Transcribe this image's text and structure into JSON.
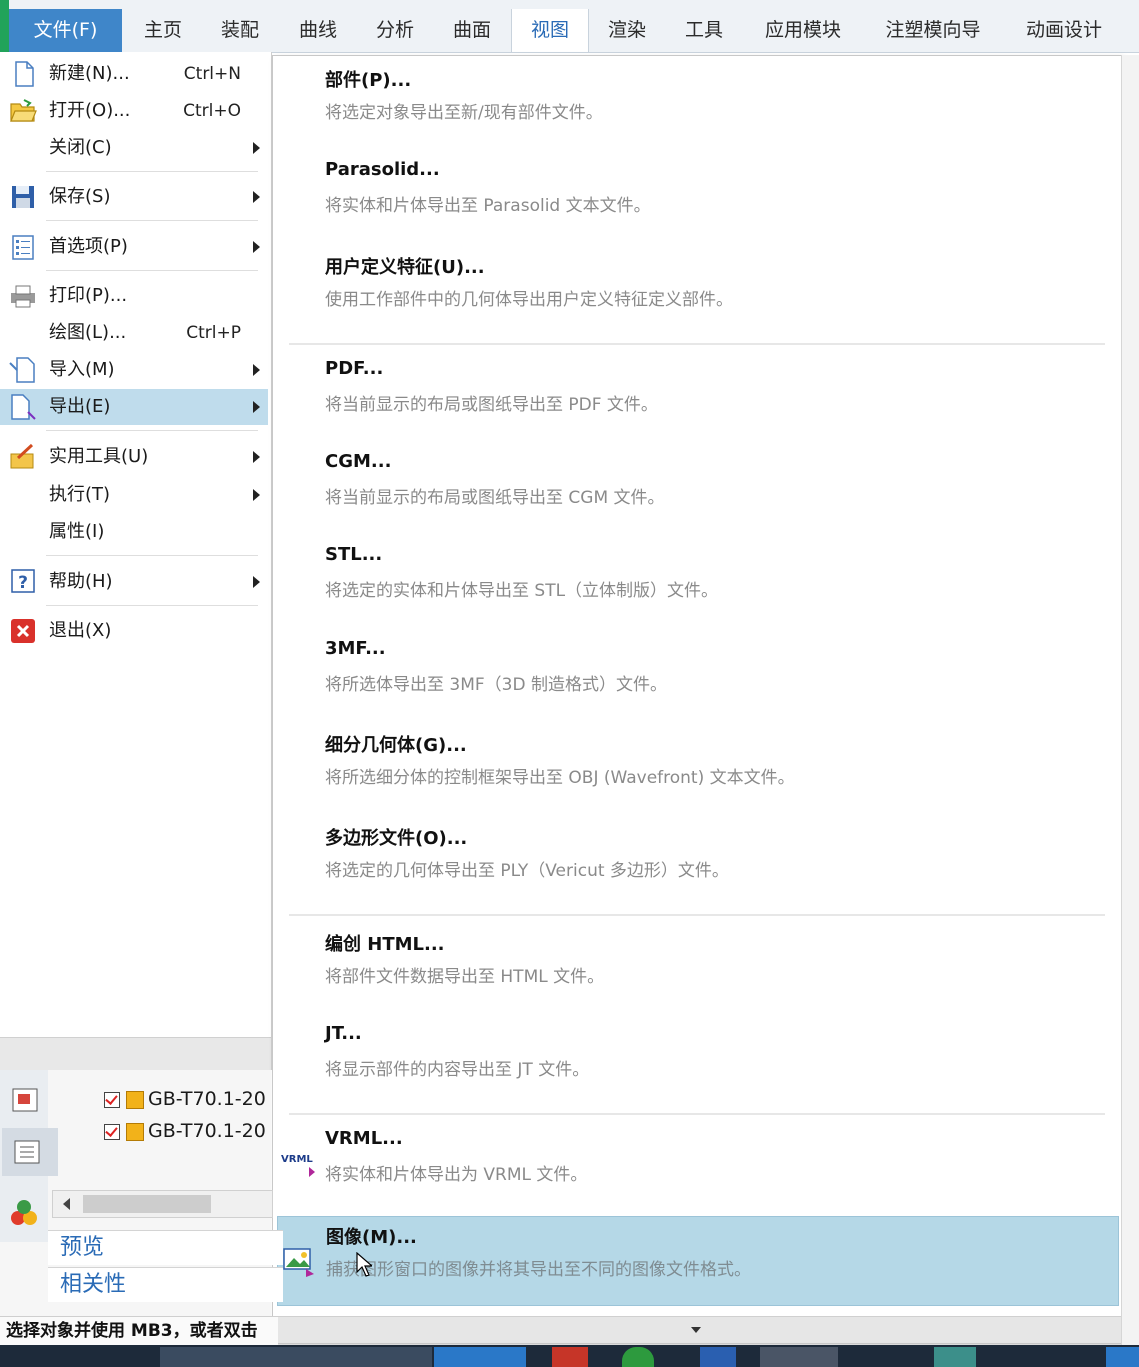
{
  "ribbon": {
    "file_tab": "文件(F)",
    "tabs": [
      "主页",
      "装配",
      "曲线",
      "分析",
      "曲面",
      "视图",
      "渲染",
      "工具",
      "应用模块",
      "注塑模向导",
      "动画设计"
    ],
    "active_tab": "视图"
  },
  "file_menu": {
    "items": [
      {
        "label": "新建(N)...",
        "shortcut": "Ctrl+N",
        "icon": "new-file-icon"
      },
      {
        "label": "打开(O)...",
        "shortcut": "Ctrl+O",
        "icon": "open-folder-icon"
      },
      {
        "label": "关闭(C)",
        "icon": ""
      },
      {
        "label": "保存(S)",
        "icon": "save-disk-icon"
      },
      {
        "label": "首选项(P)",
        "icon": "preferences-list-icon"
      },
      {
        "label": "打印(P)...",
        "icon": "printer-icon"
      },
      {
        "label": "绘图(L)...",
        "shortcut": "Ctrl+P",
        "icon": ""
      },
      {
        "label": "导入(M)",
        "icon": "import-file-icon"
      },
      {
        "label": "导出(E)",
        "icon": "export-file-icon"
      },
      {
        "label": "实用工具(U)",
        "icon": "utilities-icon"
      },
      {
        "label": "执行(T)",
        "icon": ""
      },
      {
        "label": "属性(I)",
        "icon": ""
      },
      {
        "label": "帮助(H)",
        "icon": "help-icon"
      },
      {
        "label": "退出(X)",
        "icon": "exit-icon"
      }
    ],
    "highlighted": "导出(E)"
  },
  "export_menu": {
    "items": [
      {
        "title": "部件(P)...",
        "desc": "将选定对象导出至新/现有部件文件。"
      },
      {
        "title": "Parasolid...",
        "desc": "将实体和片体导出至 Parasolid 文本文件。"
      },
      {
        "title": "用户定义特征(U)...",
        "desc": "使用工作部件中的几何体导出用户定义特征定义部件。"
      },
      {
        "title": "PDF...",
        "desc": "将当前显示的布局或图纸导出至 PDF 文件。"
      },
      {
        "title": "CGM...",
        "desc": "将当前显示的布局或图纸导出至 CGM 文件。"
      },
      {
        "title": "STL...",
        "desc": "将选定的实体和片体导出至 STL（立体制版）文件。"
      },
      {
        "title": "3MF...",
        "desc": "将所选体导出至 3MF（3D 制造格式）文件。"
      },
      {
        "title": "细分几何体(G)...",
        "desc": "将所选细分体的控制框架导出至 OBJ (Wavefront) 文本文件。"
      },
      {
        "title": "多边形文件(O)...",
        "desc": "将选定的几何体导出至 PLY（Vericut 多边形）文件。"
      },
      {
        "title": "编创 HTML...",
        "desc": "将部件文件数据导出至 HTML 文件。"
      },
      {
        "title": "JT...",
        "desc": "将显示部件的内容导出至 JT 文件。"
      },
      {
        "title": "VRML...",
        "desc": "将实体和片体导出为 VRML 文件。",
        "icon_text": "VRML"
      },
      {
        "title": "图像(M)...",
        "desc": "捕获图形窗口的图像并将其导出至不同的图像文件格式。"
      }
    ],
    "highlighted": "图像(M)..."
  },
  "navigator": {
    "tree_rows": [
      "GB-T70.1-20",
      "GB-T70.1-20"
    ],
    "links": [
      "预览",
      "相关性"
    ]
  },
  "status_bar": {
    "text": "选择对象并使用 MB3，或者双击"
  },
  "colors": {
    "file_tab": "#3f86c9",
    "highlight": "#b5d8e7",
    "accent_green": "#21a35a"
  }
}
